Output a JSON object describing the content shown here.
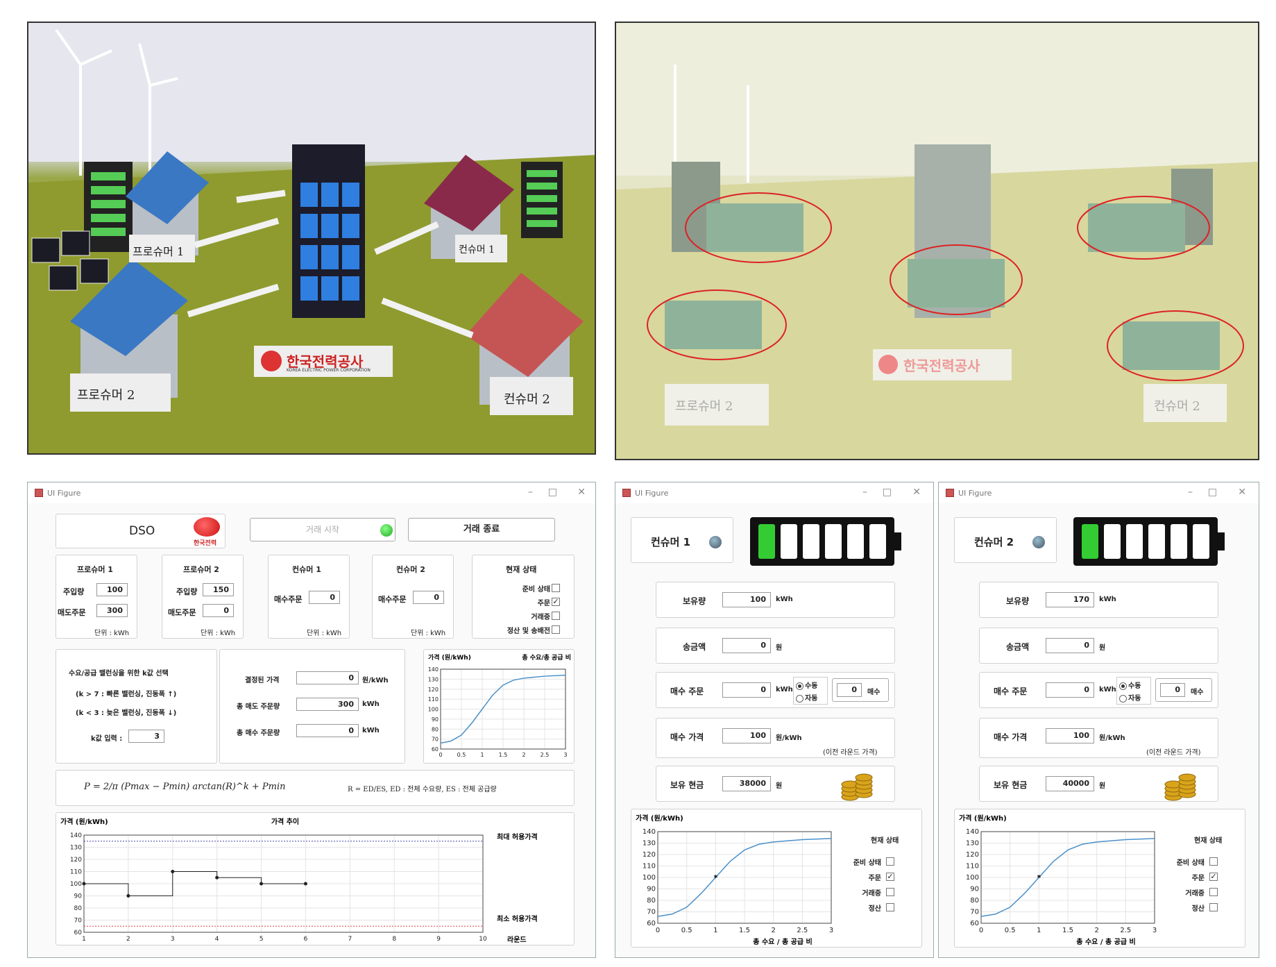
{
  "photos": {
    "left": {
      "labels": {
        "prosumer1": "프로슈머 1",
        "prosumer2": "프로슈머 2",
        "consumer1": "컨슈머 1",
        "consumer2": "컨슈머 2",
        "kepco": "한국전력공사",
        "kepco_en": "KOREA ELECTRIC POWER CORPORATION"
      }
    },
    "right": {
      "labels": {
        "prosumer2": "프로슈머 2",
        "consumer2": "컨슈머 2",
        "kepco": "한국전력공사"
      }
    }
  },
  "dso": {
    "window_title": "UI Figure",
    "title": "DSO",
    "logo_text": "한국전력",
    "start_button": "거래 시작",
    "end_button": "거래 종료",
    "prosumer1": {
      "title": "프로슈머 1",
      "inject_label": "주입량",
      "inject": "100",
      "sell_label": "매도주문",
      "sell": "300",
      "unit": "단위 : kWh"
    },
    "prosumer2": {
      "title": "프로슈머 2",
      "inject_label": "주입량",
      "inject": "150",
      "sell_label": "매도주문",
      "sell": "0",
      "unit": "단위 : kWh"
    },
    "consumer1": {
      "title": "컨슈머 1",
      "buy_label": "매수주문",
      "buy": "0",
      "unit": "단위 : kWh"
    },
    "consumer2": {
      "title": "컨슈머 2",
      "buy_label": "매수주문",
      "buy": "0",
      "unit": "단위 : kWh"
    },
    "status": {
      "title": "현재 상태",
      "items": [
        {
          "label": "준비 상태",
          "checked": false
        },
        {
          "label": "주문",
          "checked": true
        },
        {
          "label": "거래중",
          "checked": false
        },
        {
          "label": "정산 및 송배전",
          "checked": false
        }
      ]
    },
    "kpanel": {
      "title": "수요/공급 밸런싱을 위한 k값 선택",
      "line1": "(k > 7 : 빠른 밸런싱, 진동폭 ↑)",
      "line2": "(k < 3 : 늦은 밸런싱, 진동폭 ↓)",
      "input_label": "k값 입력 :",
      "input": "3"
    },
    "result": {
      "price_label": "결정된 가격",
      "price": "0",
      "price_unit": "원/kWh",
      "sell_label": "총 매도 주문량",
      "sell": "300",
      "sell_unit": "kWh",
      "buy_label": "총 매수 주문량",
      "buy": "0",
      "buy_unit": "kWh"
    },
    "formula1": "P = 2/π (Pmax − Pmin) arctan(R)^k + Pmin",
    "formula2": "R = ED/ES, ED : 전체 수요량, ES : 전체 공급량",
    "curve_chart": {
      "ylabel": "가격 (원/kWh)",
      "xlabel": "총 수요/총 공급 비",
      "yticks": [
        "140",
        "130",
        "120",
        "110",
        "100",
        "90",
        "80",
        "70",
        "60"
      ],
      "xticks": [
        "0",
        "0.5",
        "1",
        "1.5",
        "2",
        "2.5",
        "3"
      ]
    },
    "trend_chart": {
      "ylabel": "가격 (원/kWh)",
      "title": "가격 추이",
      "max_label": "최대 허용가격",
      "min_label": "최소 허용가격",
      "xlabel": "라운드",
      "yticks": [
        "140",
        "130",
        "120",
        "110",
        "100",
        "90",
        "80",
        "70",
        "60"
      ],
      "xticks": [
        "1",
        "2",
        "3",
        "4",
        "5",
        "6",
        "7",
        "8",
        "9",
        "10"
      ]
    }
  },
  "consumer_windows": [
    {
      "window_title": "UI Figure",
      "name": "컨슈머 1",
      "battery_level": 1,
      "hold_label": "보유량",
      "hold": "100",
      "hold_unit": "kWh",
      "send_label": "송금액",
      "send": "0",
      "send_unit": "원",
      "buy_label": "매수 주문",
      "buy": "0",
      "buy_unit": "kWh",
      "manual": "수동",
      "auto": "자동",
      "buy_count": "0",
      "buy_btn": "매수",
      "price_label": "매수 가격",
      "price": "100",
      "price_unit": "원/kWh",
      "price_note": "(이전 라운드 가격)",
      "cash_label": "보유 현금",
      "cash": "38000",
      "cash_unit": "원",
      "chart": {
        "ylabel": "가격 (원/kWh)",
        "xlabel": "총 수요 / 총 공급 비",
        "yticks": [
          "140",
          "130",
          "120",
          "110",
          "100",
          "90",
          "80",
          "70",
          "60"
        ],
        "xticks": [
          "0",
          "0.5",
          "1",
          "1.5",
          "2",
          "2.5",
          "3"
        ]
      },
      "status": {
        "title": "현재 상태",
        "items": [
          {
            "label": "준비 상태",
            "checked": false
          },
          {
            "label": "주문",
            "checked": true
          },
          {
            "label": "거래중",
            "checked": false
          },
          {
            "label": "정산",
            "checked": false
          }
        ]
      }
    },
    {
      "window_title": "UI Figure",
      "name": "컨슈머 2",
      "battery_level": 1,
      "hold_label": "보유량",
      "hold": "170",
      "hold_unit": "kWh",
      "send_label": "송금액",
      "send": "0",
      "send_unit": "원",
      "buy_label": "매수 주문",
      "buy": "0",
      "buy_unit": "kWh",
      "manual": "수동",
      "auto": "자동",
      "buy_count": "0",
      "buy_btn": "매수",
      "price_label": "매수 가격",
      "price": "100",
      "price_unit": "원/kWh",
      "price_note": "(이전 라운드 가격)",
      "cash_label": "보유 현금",
      "cash": "40000",
      "cash_unit": "원",
      "chart": {
        "ylabel": "가격 (원/kWh)",
        "xlabel": "총 수요 / 총 공급 비",
        "yticks": [
          "140",
          "130",
          "120",
          "110",
          "100",
          "90",
          "80",
          "70",
          "60"
        ],
        "xticks": [
          "0",
          "0.5",
          "1",
          "1.5",
          "2",
          "2.5",
          "3"
        ]
      },
      "status": {
        "title": "현재 상태",
        "items": [
          {
            "label": "준비 상태",
            "checked": false
          },
          {
            "label": "주문",
            "checked": true
          },
          {
            "label": "거래중",
            "checked": false
          },
          {
            "label": "정산",
            "checked": false
          }
        ]
      }
    }
  ],
  "chart_data": [
    {
      "type": "line",
      "title": "",
      "xlabel": "총 수요/총 공급 비",
      "ylabel": "가격 (원/kWh)",
      "xlim": [
        0,
        3
      ],
      "ylim": [
        60,
        140
      ],
      "series": [
        {
          "x": [
            0,
            0.25,
            0.5,
            0.75,
            1,
            1.25,
            1.5,
            1.75,
            2,
            2.5,
            3
          ],
          "y": [
            66,
            68,
            74,
            86,
            100,
            114,
            124,
            129,
            131,
            133,
            134
          ]
        }
      ]
    },
    {
      "type": "line",
      "title": "가격 추이",
      "xlabel": "라운드",
      "ylabel": "가격 (원/kWh)",
      "xlim": [
        1,
        10
      ],
      "ylim": [
        60,
        140
      ],
      "series": [
        {
          "x": [
            1,
            2,
            3,
            4,
            5,
            6
          ],
          "y": [
            100,
            90,
            110,
            105,
            100,
            100
          ]
        }
      ],
      "reference_lines": [
        {
          "name": "최대 허용가격",
          "y": 135
        },
        {
          "name": "최소 허용가격",
          "y": 65
        }
      ]
    },
    {
      "type": "line",
      "title": "",
      "xlabel": "총 수요 / 총 공급 비",
      "ylabel": "가격 (원/kWh)",
      "xlim": [
        0,
        3
      ],
      "ylim": [
        60,
        140
      ],
      "series": [
        {
          "x": [
            0,
            0.25,
            0.5,
            0.75,
            1,
            1.25,
            1.5,
            1.75,
            2,
            2.5,
            3
          ],
          "y": [
            66,
            68,
            74,
            86,
            100,
            114,
            124,
            129,
            131,
            133,
            134
          ]
        }
      ],
      "marker": {
        "x": 1,
        "y": 100
      }
    },
    {
      "type": "line",
      "title": "",
      "xlabel": "총 수요 / 총 공급 비",
      "ylabel": "가격 (원/kWh)",
      "xlim": [
        0,
        3
      ],
      "ylim": [
        60,
        140
      ],
      "series": [
        {
          "x": [
            0,
            0.25,
            0.5,
            0.75,
            1,
            1.25,
            1.5,
            1.75,
            2,
            2.5,
            3
          ],
          "y": [
            66,
            68,
            74,
            86,
            100,
            114,
            124,
            129,
            131,
            133,
            134
          ]
        }
      ],
      "marker": {
        "x": 1,
        "y": 100
      }
    }
  ]
}
